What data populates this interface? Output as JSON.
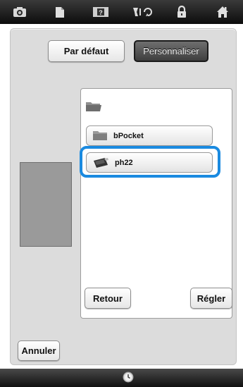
{
  "toolbar": {
    "icons": [
      "camera-icon",
      "document-icon",
      "help-icon",
      "thread-rotate-icon",
      "lock-icon",
      "home-icon"
    ]
  },
  "mode_buttons": {
    "default_label": "Par défaut",
    "custom_label": "Personnaliser",
    "selected": "custom"
  },
  "file_browser": {
    "items": [
      {
        "name": "bPocket",
        "icon": "folder-icon"
      },
      {
        "name": "ph22",
        "icon": "usb-device-icon",
        "selected": true
      }
    ],
    "back_label": "Retour",
    "set_label": "Régler"
  },
  "footer": {
    "cancel_label": "Annuler",
    "status_icon": "clock-icon"
  },
  "colors": {
    "selection_outline": "#1a8ae0",
    "toolbar_bg": "#1a1a1a",
    "panel_bg": "#dcdcdc"
  }
}
